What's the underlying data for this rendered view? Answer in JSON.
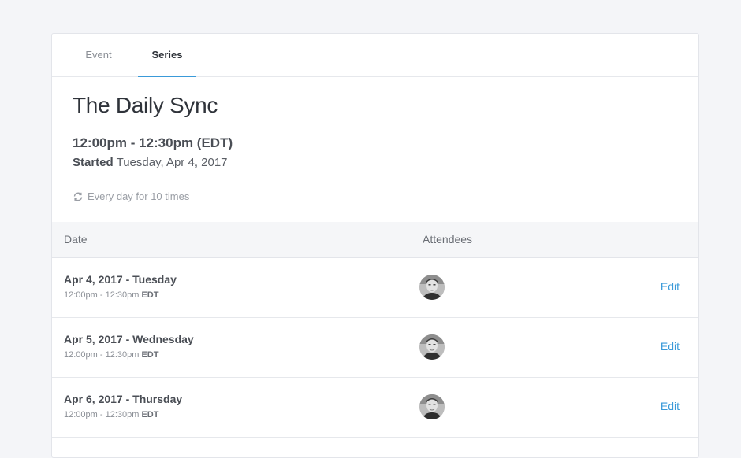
{
  "tabs": {
    "event_label": "Event",
    "series_label": "Series"
  },
  "header": {
    "title": "The Daily Sync",
    "time_range": "12:00pm - 12:30pm (EDT)",
    "started_label": "Started",
    "started_date": "Tuesday, Apr 4, 2017",
    "recurrence": "Every day for 10 times"
  },
  "table": {
    "columns": {
      "date": "Date",
      "attendees": "Attendees"
    },
    "rows": [
      {
        "date": "Apr 4, 2017 - Tuesday",
        "time": "12:00pm - 12:30pm",
        "tz": "EDT",
        "edit": "Edit"
      },
      {
        "date": "Apr 5, 2017 - Wednesday",
        "time": "12:00pm - 12:30pm",
        "tz": "EDT",
        "edit": "Edit"
      },
      {
        "date": "Apr 6, 2017 - Thursday",
        "time": "12:00pm - 12:30pm",
        "tz": "EDT",
        "edit": "Edit"
      }
    ]
  },
  "colors": {
    "accent": "#3a9ad9",
    "background": "#f4f5f8"
  },
  "icons": {
    "recurrence": "repeat-icon",
    "avatar": "user-avatar"
  }
}
